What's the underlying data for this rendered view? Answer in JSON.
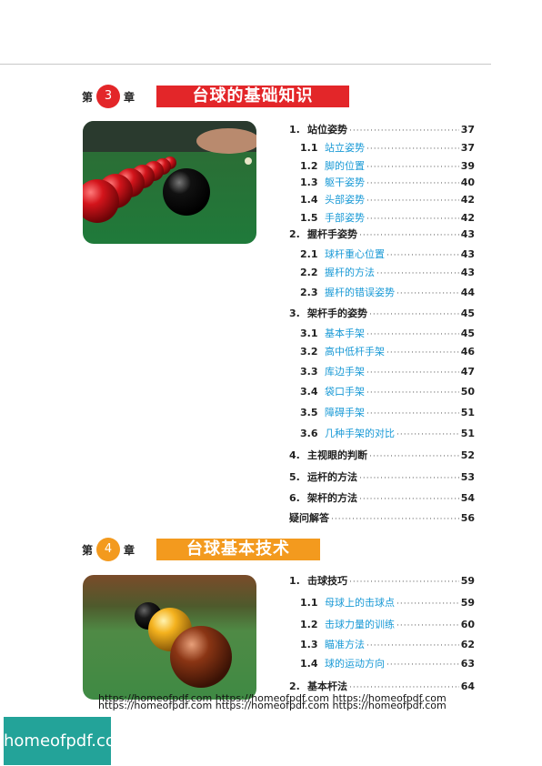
{
  "chapters": [
    {
      "word_left": "第",
      "number": "3",
      "word_right": "章",
      "title": "台球的基础知识",
      "color": "#e32629",
      "items": [
        {
          "level": "main",
          "num": "1.",
          "title": "站位姿势",
          "page": "37"
        },
        {
          "level": "sub",
          "num": "1.1",
          "title": "站立姿势",
          "page": "37"
        },
        {
          "level": "sub",
          "num": "1.2",
          "title": "脚的位置",
          "page": "39"
        },
        {
          "level": "sub",
          "num": "1.3",
          "title": "躯干姿势",
          "page": "40"
        },
        {
          "level": "sub",
          "num": "1.4",
          "title": "头部姿势",
          "page": "42"
        },
        {
          "level": "sub",
          "num": "1.5",
          "title": "手部姿势",
          "page": "42"
        },
        {
          "level": "main",
          "num": "2.",
          "title": "握杆手姿势",
          "page": "43"
        },
        {
          "level": "sub",
          "num": "2.1",
          "title": "球杆重心位置",
          "page": "43"
        },
        {
          "level": "sub",
          "num": "2.2",
          "title": "握杆的方法",
          "page": "43"
        },
        {
          "level": "sub",
          "num": "2.3",
          "title": "握杆的错误姿势",
          "page": "44"
        },
        {
          "level": "main",
          "num": "3.",
          "title": "架杆手的姿势",
          "page": "45"
        },
        {
          "level": "sub",
          "num": "3.1",
          "title": "基本手架",
          "page": "45"
        },
        {
          "level": "sub",
          "num": "3.2",
          "title": "高中低杆手架",
          "page": "46"
        },
        {
          "level": "sub",
          "num": "3.3",
          "title": "库边手架",
          "page": "47"
        },
        {
          "level": "sub",
          "num": "3.4",
          "title": "袋口手架",
          "page": "50"
        },
        {
          "level": "sub",
          "num": "3.5",
          "title": "障碍手架",
          "page": "51"
        },
        {
          "level": "sub",
          "num": "3.6",
          "title": "几种手架的对比",
          "page": "51"
        },
        {
          "level": "main",
          "num": "4.",
          "title": "主视眼的判断",
          "page": "52"
        },
        {
          "level": "main",
          "num": "5.",
          "title": "运杆的方法",
          "page": "53"
        },
        {
          "level": "main",
          "num": "6.",
          "title": "架杆的方法",
          "page": "54"
        },
        {
          "level": "main",
          "num": "",
          "title": "疑问解答",
          "page": "56"
        }
      ]
    },
    {
      "word_left": "第",
      "number": "4",
      "word_right": "章",
      "title": "台球基本技术",
      "color": "#f39a1e",
      "items": [
        {
          "level": "main",
          "num": "1.",
          "title": "击球技巧",
          "page": "59"
        },
        {
          "level": "sub",
          "num": "1.1",
          "title": "母球上的击球点",
          "page": "59"
        },
        {
          "level": "sub",
          "num": "1.2",
          "title": "击球力量的训练",
          "page": "60"
        },
        {
          "level": "sub",
          "num": "1.3",
          "title": "瞄准方法",
          "page": "62"
        },
        {
          "level": "sub",
          "num": "1.4",
          "title": "球的运动方向",
          "page": "63"
        },
        {
          "level": "main",
          "num": "2.",
          "title": "基本杆法",
          "page": "64"
        }
      ]
    }
  ],
  "watermark": {
    "line1": "https://homeofpdf.com https://homeofpdf.com https://homeofpdf.com",
    "line2": "https://homeofpdf.com https://homeofpdf.com https://homeofpdf.com"
  },
  "logo_text": "homeofpdf.com"
}
